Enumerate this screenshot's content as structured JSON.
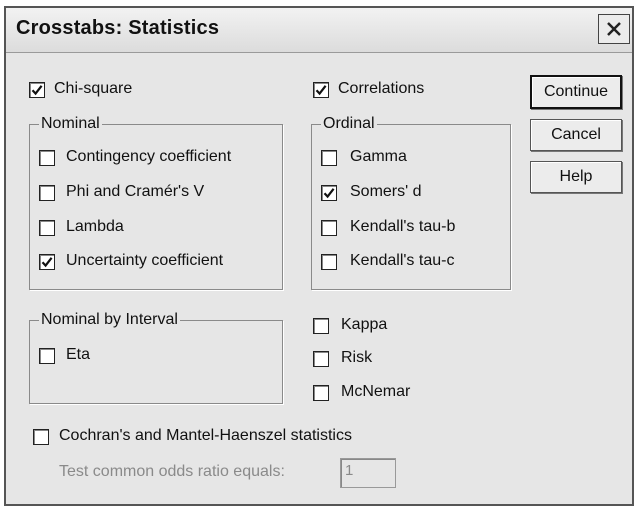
{
  "dialog": {
    "title": "Crosstabs: Statistics"
  },
  "buttons": {
    "continue": "Continue",
    "cancel": "Cancel",
    "help": "Help"
  },
  "options": {
    "chi_square": {
      "label": "Chi-square",
      "checked": true
    },
    "correlations": {
      "label": "Correlations",
      "checked": true
    },
    "kappa": {
      "label": "Kappa",
      "checked": false
    },
    "risk": {
      "label": "Risk",
      "checked": false
    },
    "mcnemar": {
      "label": "McNemar",
      "checked": false
    },
    "cochran": {
      "label": "Cochran's and Mantel-Haenszel statistics",
      "checked": false
    }
  },
  "nominal": {
    "legend": "Nominal",
    "items": [
      {
        "label": "Contingency coefficient",
        "checked": false
      },
      {
        "label": "Phi and Cramér's V",
        "checked": false
      },
      {
        "label": "Lambda",
        "checked": false
      },
      {
        "label": "Uncertainty coefficient",
        "checked": true
      }
    ]
  },
  "ordinal": {
    "legend": "Ordinal",
    "items": [
      {
        "label": "Gamma",
        "checked": false
      },
      {
        "label": "Somers' d",
        "checked": true
      },
      {
        "label": "Kendall's tau-b",
        "checked": false
      },
      {
        "label": "Kendall's tau-c",
        "checked": false
      }
    ]
  },
  "nominal_by_interval": {
    "legend": "Nominal by Interval",
    "items": [
      {
        "label": "Eta",
        "checked": false
      }
    ]
  },
  "odds": {
    "label": "Test common odds ratio equals:",
    "value": "1"
  }
}
